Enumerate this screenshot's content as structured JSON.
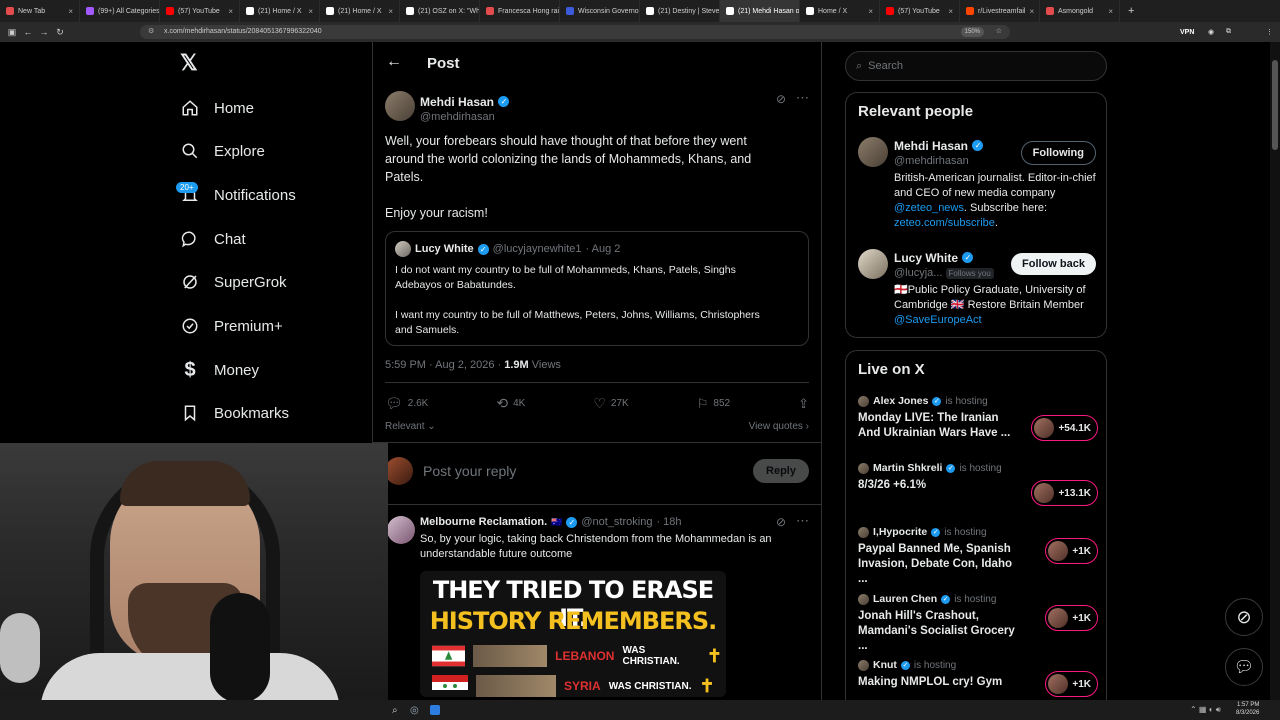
{
  "browser": {
    "tabs": [
      {
        "label": "New Tab",
        "color": "#e34c4c"
      },
      {
        "label": "(99+) All Categories",
        "color": "#a259ff"
      },
      {
        "label": "(57) YouTube",
        "color": "#ff0000"
      },
      {
        "label": "(21) Home / X",
        "color": "#ffffff"
      },
      {
        "label": "(21) Home / X",
        "color": "#ffffff"
      },
      {
        "label": "(21) OSZ on X: \"Wh",
        "color": "#ffffff"
      },
      {
        "label": "Francesca Hong rai",
        "color": "#e34c4c"
      },
      {
        "label": "Wisconsin Governo",
        "color": "#3b5bdb"
      },
      {
        "label": "(21) Destiny | Steve",
        "color": "#ffffff"
      },
      {
        "label": "(21) Mehdi Hasan o",
        "color": "#ffffff",
        "active": true
      },
      {
        "label": "Home / X",
        "color": "#ffffff"
      },
      {
        "label": "(57) YouTube",
        "color": "#ff0000"
      },
      {
        "label": "r/Livestreamfail",
        "color": "#ff4500"
      },
      {
        "label": "Asmongold",
        "color": "#e34c4c"
      }
    ],
    "url": "x.com/mehdirhasan/status/2084051367996322040",
    "zoom": "150%",
    "vpn": "VPN"
  },
  "sidebar": {
    "logo": "𝕏",
    "items": [
      {
        "label": "Home"
      },
      {
        "label": "Explore"
      },
      {
        "label": "Notifications",
        "badge": "20+"
      },
      {
        "label": "Chat"
      },
      {
        "label": "SuperGrok"
      },
      {
        "label": "Premium+"
      },
      {
        "label": "Money"
      },
      {
        "label": "Bookmarks"
      }
    ]
  },
  "post": {
    "header": "Post",
    "author": {
      "name": "Mehdi Hasan",
      "handle": "@mehdirhasan"
    },
    "text": "Well, your forebears should have thought of that before they went\naround the world colonizing the lands of Mohammeds, Khans, and\nPatels.\n\nEnjoy your racism!",
    "quote": {
      "name": "Lucy White",
      "handle": "@lucyjaynewhite1",
      "date": "· Aug 2",
      "text": "I do not want my country to be full of Mohammeds, Khans, Patels, Singhs\nAdebayos or Babatundes.\n\nI want my country to be full of Matthews, Peters, Johns, Williams, Christophers\nand Samuels."
    },
    "time": "5:59 PM · Aug 2, 2026 ·",
    "views_count": "1.9M",
    "views_label": "Views",
    "replies": "2.6K",
    "reposts": "4K",
    "likes": "27K",
    "bookmarks": "852",
    "sort": "Relevant",
    "view_quotes": "View quotes",
    "reply_placeholder": "Post your reply",
    "reply_button": "Reply"
  },
  "reply": {
    "name": "Melbourne Reclamation.",
    "handle": "@not_stroking",
    "age": "· 18h",
    "text": "So, by your logic, taking back Christendom from the Mohammedan is an\nunderstandable future outcome",
    "image": {
      "title1": "THEY TRIED TO ERASE IT.",
      "title2": "HISTORY REMEMBERS.",
      "rows": [
        {
          "country": "LEBANON",
          "suffix": "WAS CHRISTIAN."
        },
        {
          "country": "SYRIA",
          "suffix": "WAS CHRISTIAN."
        }
      ]
    }
  },
  "search": {
    "placeholder": "Search"
  },
  "relevant": {
    "title": "Relevant people",
    "people": [
      {
        "name": "Mehdi Hasan",
        "handle": "@mehdirhasan",
        "button": "Following",
        "bio_pre": "British-American journalist. Editor-in-chief and CEO of new media company ",
        "bio_link1": "@zeteo_news",
        "bio_mid": ". Subscribe here: ",
        "bio_link2": "zeteo.com/subscribe",
        "bio_post": "."
      },
      {
        "name": "Lucy White",
        "handle": "@lucyja...",
        "follows_you": "Follows you",
        "button": "Follow back",
        "bio_pre": "🏴󠁧󠁢󠁥󠁮󠁧󠁿Public Policy Graduate, University of Cambridge 🇬🇧 Restore Britain Member ",
        "bio_link1": "@SaveEuropeAct"
      }
    ]
  },
  "live": {
    "title": "Live on X",
    "items": [
      {
        "host": "Alex Jones",
        "status": "is hosting",
        "title": "Monday LIVE: The Iranian And Ukrainian Wars Have ...",
        "count": "+54.1K"
      },
      {
        "host": "Martin Shkreli",
        "status": "is hosting",
        "title": "8/3/26 +6.1%",
        "count": "+13.1K"
      },
      {
        "host": "I,Hypocrite",
        "status": "is hosting",
        "title": "Paypal Banned Me, Spanish Invasion, Debate Con, Idaho ...",
        "count": "+1K"
      },
      {
        "host": "Lauren Chen",
        "status": "is hosting",
        "title": "Jonah Hill's Crashout, Mamdani's Socialist Grocery ...",
        "count": "+1K"
      },
      {
        "host": "Knut",
        "status": "is hosting",
        "title": "Making NMPLOL cry! Gym",
        "count": "+1K"
      }
    ]
  },
  "taskbar": {
    "time": "1:57 PM",
    "date": "8/3/2026"
  }
}
